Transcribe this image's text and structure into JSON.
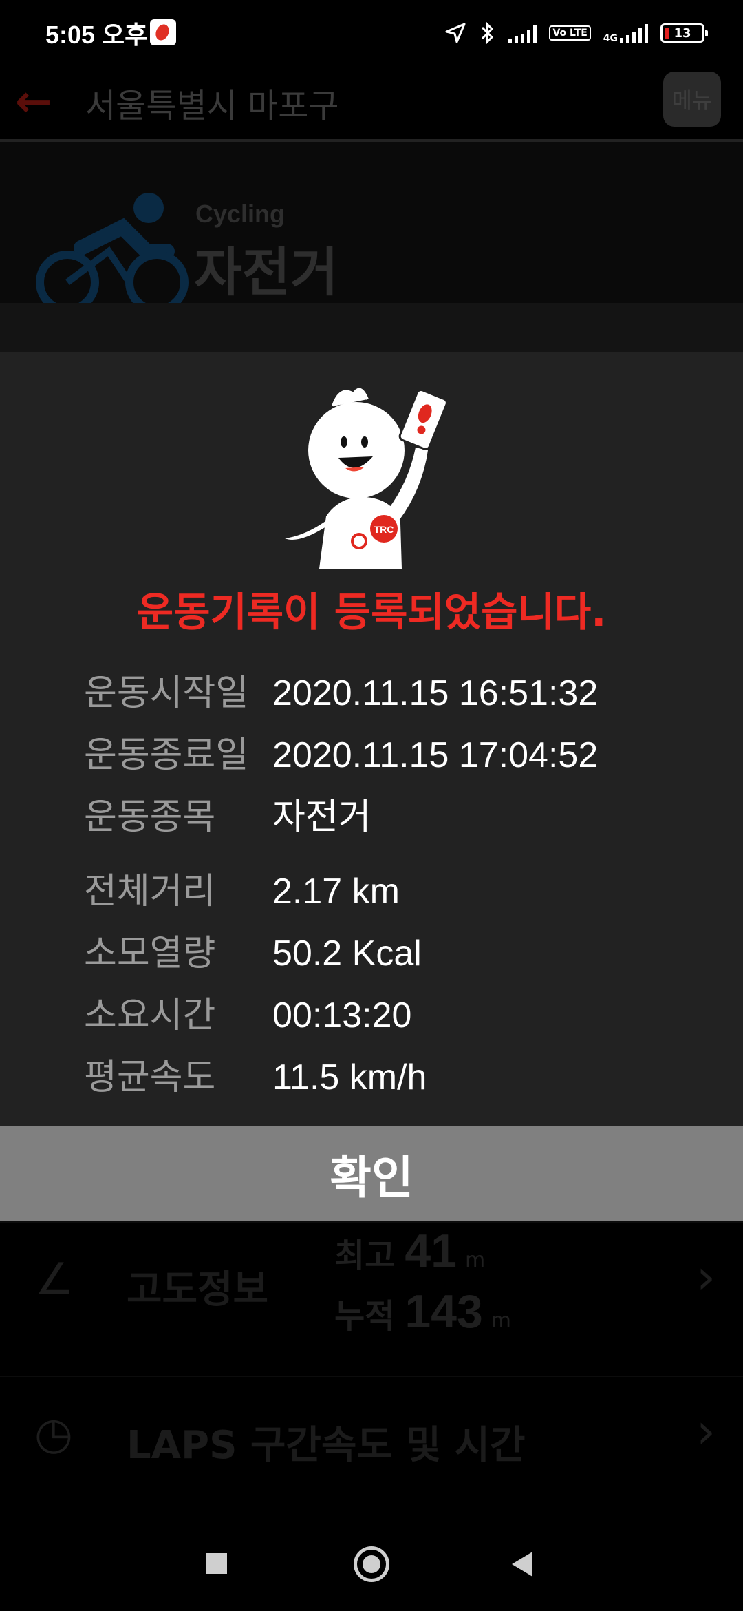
{
  "status_bar": {
    "time": "5:05 오후",
    "volte": "Vo LTE",
    "network": "4G",
    "battery": "13"
  },
  "header": {
    "title": "서울특별시 마포구",
    "menu_label": "메뉴"
  },
  "hero": {
    "sport_en": "Cycling",
    "sport_kr": "자전거"
  },
  "background_rows": {
    "altitude": {
      "label": "고도정보",
      "max_label": "최고",
      "max_value": "41",
      "max_unit": "m",
      "cum_label": "누적",
      "cum_value": "143",
      "cum_unit": "m"
    },
    "laps": {
      "label": "LAPS 구간속도 및 시간"
    }
  },
  "dialog": {
    "title": "운동기록이 등록되었습니다.",
    "rows": [
      {
        "key": "운동시작일",
        "value": "2020.11.15 16:51:32"
      },
      {
        "key": "운동종료일",
        "value": "2020.11.15 17:04:52"
      },
      {
        "key": "운동종목",
        "value": "자전거"
      },
      {
        "key": "전체거리",
        "value": "2.17 km"
      },
      {
        "key": "소모열량",
        "value": "50.2 Kcal"
      },
      {
        "key": "소요시간",
        "value": "00:13:20"
      },
      {
        "key": "평균속도",
        "value": "11.5 km/h"
      }
    ],
    "confirm_label": "확인",
    "mascot_badge": "TRC"
  },
  "colors": {
    "accent_red": "#ee2a23",
    "modal_bg": "#222222",
    "confirm_bg": "#808080"
  }
}
